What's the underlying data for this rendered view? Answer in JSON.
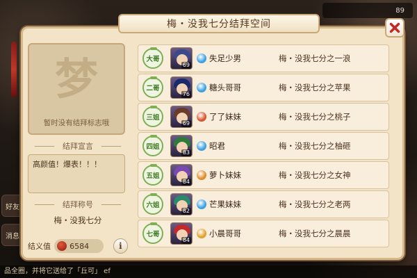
{
  "window": {
    "title": "梅・没我七分结拜空间"
  },
  "background": {
    "top_right_counter": "89",
    "chat_text": "品全圈，并将它送给了「丘可」 ef",
    "left_icons": [
      "好友",
      "消息"
    ]
  },
  "left_panel": {
    "emblem_placeholder_glyph": "梦",
    "emblem_text": "暂时没有结拜标志哦",
    "declaration_label": "结拜宣言",
    "declaration_text": "高颜值！爆表！！！",
    "title_label": "结拜称号",
    "title_value": "梅・没我七分",
    "bond_value_label": "结义值",
    "bond_value": "6584",
    "info_button": "i"
  },
  "members": [
    {
      "rank": "大哥",
      "level": "69",
      "name": "失足少男",
      "title": "梅・没我七分之一浪",
      "school_color": "#3aa0e0",
      "hair_color": "#3a4a8a"
    },
    {
      "rank": "二哥",
      "level": "76",
      "name": "糖头哥哥",
      "title": "梅・没我七分之苹果",
      "school_color": "#3aa0e0",
      "hair_color": "#1a2a6a"
    },
    {
      "rank": "三姐",
      "level": "69",
      "name": "了了妹妹",
      "title": "梅・没我七分之桃子",
      "school_color": "#d8542a",
      "hair_color": "#6a3a2a"
    },
    {
      "rank": "四姐",
      "level": "83",
      "name": "昭君",
      "title": "梅・没我七分之柚砸",
      "school_color": "#3aa0e0",
      "hair_color": "#2e7a3a"
    },
    {
      "rank": "五姐",
      "level": "84",
      "name": "萝卜妹妹",
      "title": "梅・没我七分之女神",
      "school_color": "#e08a2a",
      "hair_color": "#7a4ab0"
    },
    {
      "rank": "六姐",
      "level": "82",
      "name": "芒果妹妹",
      "title": "梅・没我七分之老两",
      "school_color": "#3aa0e0",
      "hair_color": "#2a8a6a"
    },
    {
      "rank": "七哥",
      "level": "84",
      "name": "小晨哥哥",
      "title": "梅・没我七分之晨晨",
      "school_color": "#e0a02a",
      "hair_color": "#c02a2a"
    }
  ],
  "colors": {
    "panel_bg": "#f3e4c7",
    "rank_green": "#7fae55",
    "close_red": "#c0282a"
  }
}
